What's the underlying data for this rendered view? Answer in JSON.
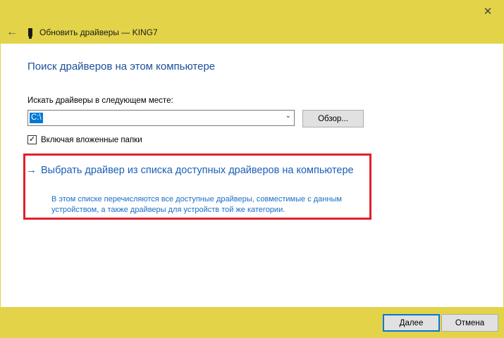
{
  "window": {
    "title": "Обновить драйверы — KING7",
    "close_glyph": "✕",
    "back_glyph": "←"
  },
  "content": {
    "heading": "Поиск драйверов на этом компьютере",
    "path_label": "Искать драйверы в следующем месте:",
    "path_value": "C:\\",
    "browse_label": "Обзор...",
    "include_subfolders_label": "Включая вложенные папки",
    "include_subfolders_checked": true
  },
  "pick_option": {
    "title": "Выбрать драйвер из списка доступных драйверов на компьютере",
    "description": "В этом списке перечисляются все доступные драйверы, совместимые с данным устройством, а также драйверы для устройств той же категории."
  },
  "buttons": {
    "next": "Далее",
    "cancel": "Отмена"
  },
  "colors": {
    "titlebar_bg": "#e3d349",
    "heading_color": "#1c4f9c",
    "link_color": "#1a5fb4",
    "highlight_border": "#e0202c",
    "selection": "#0078d7"
  },
  "icons": {
    "back": "arrow-left-icon",
    "device": "usb-device-icon",
    "close": "close-icon",
    "dropdown": "chevron-down-icon",
    "link_arrow": "arrow-right-icon"
  }
}
